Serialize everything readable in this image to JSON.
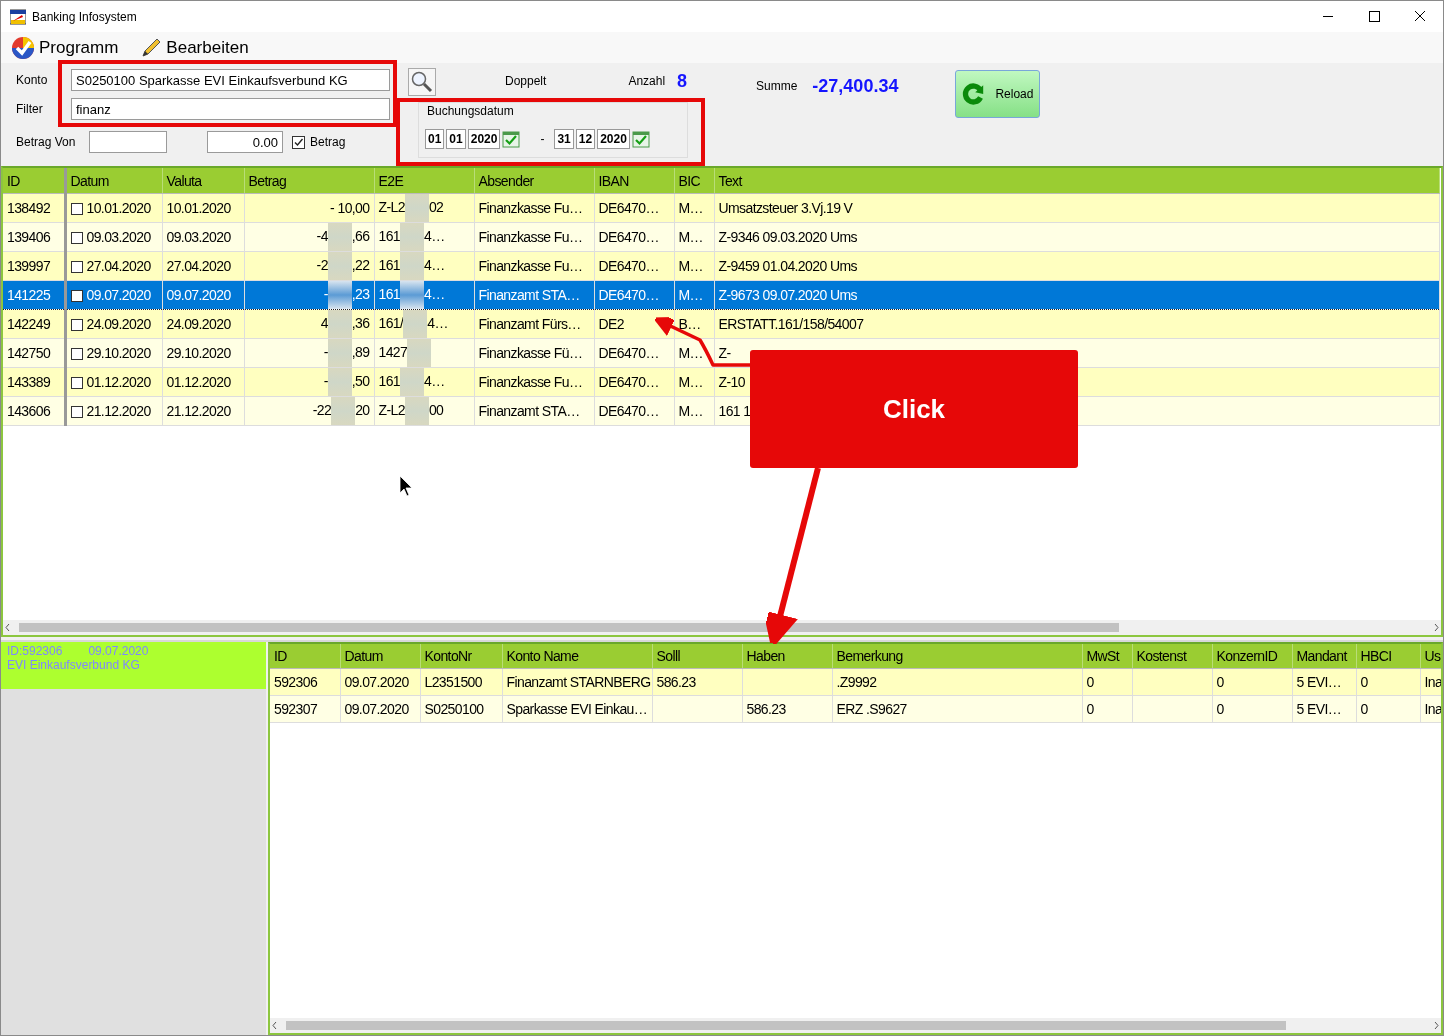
{
  "window": {
    "title": "Banking Infosystem"
  },
  "menu": [
    {
      "label": "Programm"
    },
    {
      "label": "Bearbeiten"
    }
  ],
  "filters": {
    "konto_label": "Konto",
    "konto_value": "S0250100 Sparkasse EVI Einkaufsverbund KG",
    "filter_label": "Filter",
    "filter_value": "finanz",
    "betrag_von_label": "Betrag Von",
    "betrag_bis_value": "0.00",
    "betrag_checkbox": {
      "label": "Betrag",
      "checked": true
    }
  },
  "doppelt_label": "Doppelt",
  "anzahl": {
    "label": "Anzahl",
    "value": "8"
  },
  "summe": {
    "label": "Summe",
    "value": "-27,400.34"
  },
  "buchungsdatum": {
    "label": "Buchungsdatum",
    "from": [
      "01",
      "01",
      "2020"
    ],
    "separator": "-",
    "to": [
      "31",
      "12",
      "2020"
    ]
  },
  "reload_button": "Reload",
  "transactions": {
    "columns": [
      "ID",
      "Datum",
      "Valuta",
      "Betrag",
      "E2E",
      "Absender",
      "IBAN",
      "BIC",
      "Text"
    ],
    "rows": [
      {
        "selected": false,
        "checked": false,
        "cells": [
          "138492",
          "10.01.2020",
          "10.01.2020",
          "- 10,00",
          {
            "kind": "redacted",
            "before": "Z-L2",
            "after": "02"
          },
          "Finanzkasse  Fu…",
          "DE6470…",
          "M…",
          "Umsatzsteuer 3.Vj.19 V"
        ]
      },
      {
        "selected": false,
        "checked": false,
        "cells": [
          "139406",
          "09.03.2020",
          "09.03.2020",
          {
            "kind": "redacted",
            "before": "-4",
            "after": ",66"
          },
          {
            "kind": "redacted",
            "before": "161",
            "after": "4…"
          },
          "Finanzkasse  Fu…",
          "DE6470…",
          "M…",
          "Z-9346  09.03.2020 Ums"
        ]
      },
      {
        "selected": false,
        "checked": false,
        "cells": [
          "139997",
          "27.04.2020",
          "27.04.2020",
          {
            "kind": "redacted",
            "before": "-2",
            "after": ",22"
          },
          {
            "kind": "redacted",
            "before": "161",
            "after": "4…"
          },
          "Finanzkasse  Fu…",
          "DE6470…",
          "M…",
          "Z-9459  01.04.2020 Ums"
        ]
      },
      {
        "selected": true,
        "checked": false,
        "cells": [
          "141225",
          "09.07.2020",
          "09.07.2020",
          {
            "kind": "redacted",
            "before": "-",
            "after": ",23"
          },
          {
            "kind": "redacted",
            "before": "161",
            "after": "4…"
          },
          "Finanzamt  STA…",
          "DE6470…",
          "M…",
          "Z-9673  09.07.2020 Ums"
        ]
      },
      {
        "selected": false,
        "checked": false,
        "cells": [
          "142249",
          "24.09.2020",
          "24.09.2020",
          {
            "kind": "redacted",
            "before": "4",
            "after": ",36"
          },
          {
            "kind": "redacted",
            "before": "161/",
            "after": "4…"
          },
          "Finanzamt  Fürs…",
          "DE2",
          "B…",
          "ERSTATT.161/158/54007"
        ]
      },
      {
        "selected": false,
        "checked": false,
        "cells": [
          "142750",
          "29.10.2020",
          "29.10.2020",
          {
            "kind": "redacted",
            "before": "-",
            "after": ",89"
          },
          {
            "kind": "redacted",
            "before": "1427"
          },
          "Finanzkasse  Fü…",
          "DE6470…",
          "M…",
          "Z-"
        ]
      },
      {
        "selected": false,
        "checked": false,
        "cells": [
          "143389",
          "01.12.2020",
          "01.12.2020",
          {
            "kind": "redacted",
            "before": "-",
            "after": ",50"
          },
          {
            "kind": "redacted",
            "before": "161",
            "after": "4…"
          },
          "Finanzkasse  Fu…",
          "DE6470…",
          "M…",
          "Z-10"
        ]
      },
      {
        "selected": false,
        "checked": false,
        "cells": [
          "143606",
          "21.12.2020",
          "21.12.2020",
          {
            "kind": "redacted",
            "before": "-22",
            "after": "20"
          },
          {
            "kind": "redacted",
            "before": "Z-L2",
            "after": "00"
          },
          "Finanzamt  STA…",
          "DE6470…",
          "M…",
          "161 1"
        ]
      }
    ]
  },
  "detail_info": {
    "id": "ID:592306",
    "date": "09.07.2020",
    "name": "EVI Einkaufsverbund KG"
  },
  "bookings": {
    "columns": [
      "ID",
      "Datum",
      "KontoNr",
      "Konto Name",
      "Solll",
      "Haben",
      "Bemerkung",
      "MwSt",
      "Kostenst",
      "KonzernID",
      "Mandant",
      "HBCI",
      "Us"
    ],
    "rows": [
      {
        "cells": [
          "592306",
          "09.07.2020",
          "L2351500",
          "Finanzamt STARNBERG",
          "586.23",
          "",
          ".Z9992",
          "0",
          "",
          "0",
          "5 EVI…",
          "0",
          "Ina"
        ]
      },
      {
        "cells": [
          "592307",
          "09.07.2020",
          "S0250100",
          "Sparkasse  EVI  Einkau…",
          "",
          "586.23",
          "ERZ .S9627",
          "0",
          "",
          "0",
          "5 EVI…",
          "0",
          "Ina"
        ]
      }
    ]
  },
  "annotation": {
    "callout": "Click"
  }
}
